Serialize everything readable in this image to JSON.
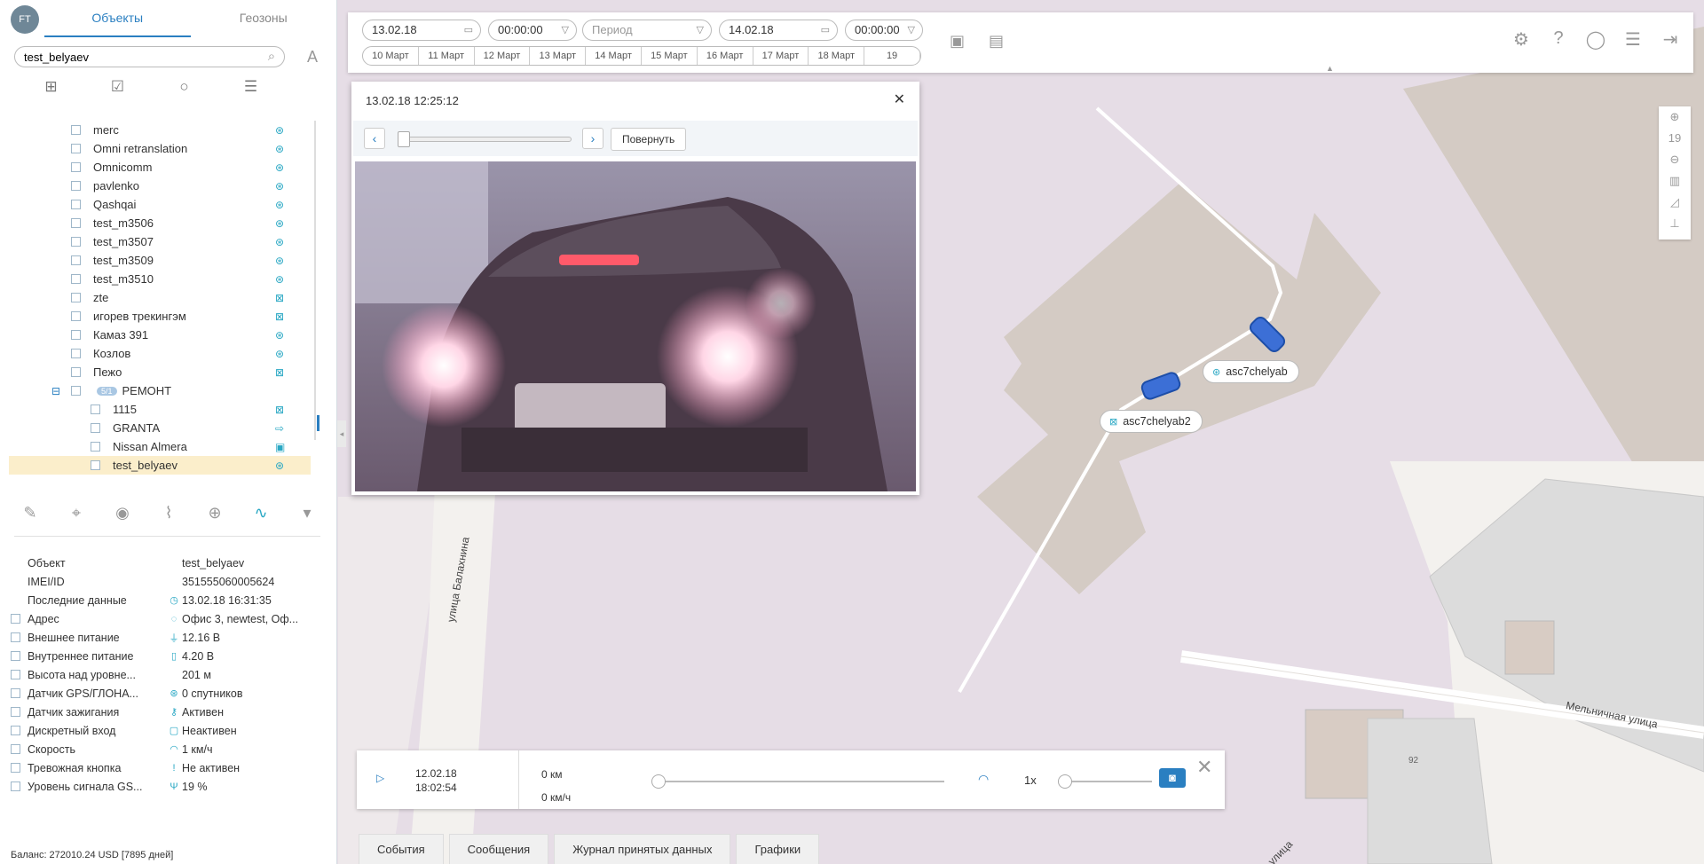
{
  "sidebar": {
    "logo": "FT",
    "tabs": [
      "Объекты",
      "Геозоны"
    ],
    "search_value": "test_belyaev",
    "font_toggle": "A",
    "objects": [
      {
        "name": "merc"
      },
      {
        "name": "Omni retranslation"
      },
      {
        "name": "Omnicomm"
      },
      {
        "name": "pavlenko"
      },
      {
        "name": "Qashqai"
      },
      {
        "name": "test_m3506"
      },
      {
        "name": "test_m3507"
      },
      {
        "name": "test_m3509"
      },
      {
        "name": "test_m3510"
      },
      {
        "name": "zte"
      },
      {
        "name": "игорев трекингэм"
      },
      {
        "name": "Камаз 391"
      },
      {
        "name": "Козлов"
      },
      {
        "name": "Пежо"
      }
    ],
    "group": {
      "badge": "5/1",
      "name": "РЕМОНТ"
    },
    "group_items": [
      {
        "name": "1115"
      },
      {
        "name": "GRANTA"
      },
      {
        "name": "Nissan Almera"
      },
      {
        "name": "test_belyaev",
        "selected": true
      }
    ],
    "properties": [
      {
        "label": "Объект",
        "value": "test_belyaev",
        "checkbox": false,
        "icon": ""
      },
      {
        "label": "IMEI/ID",
        "value": "351555060005624",
        "checkbox": false,
        "icon": ""
      },
      {
        "label": "Последние данные",
        "value": "13.02.18 16:31:35",
        "checkbox": false,
        "icon": "clock-icon"
      },
      {
        "label": "Адрес",
        "value": "Офис 3, newtest, Оф...",
        "checkbox": true,
        "icon": "pin-icon"
      },
      {
        "label": "Внешнее питание",
        "value": "12.16 В",
        "checkbox": true,
        "icon": "plug-icon"
      },
      {
        "label": "Внутреннее питание",
        "value": "4.20 В",
        "checkbox": true,
        "icon": "battery-icon"
      },
      {
        "label": "Высота над уровне...",
        "value": "201 м",
        "checkbox": true,
        "icon": ""
      },
      {
        "label": "Датчик GPS/ГЛОНА...",
        "value": "0 спутников",
        "checkbox": true,
        "icon": "satellite-icon"
      },
      {
        "label": "Датчик зажигания",
        "value": "Активен",
        "checkbox": true,
        "icon": "key-icon"
      },
      {
        "label": "Дискретный вход",
        "value": "Неактивен",
        "checkbox": true,
        "icon": "input-icon"
      },
      {
        "label": "Скорость",
        "value": "1 км/ч",
        "checkbox": true,
        "icon": "speed-icon"
      },
      {
        "label": "Тревожная кнопка",
        "value": "Не активен",
        "checkbox": true,
        "icon": "alarm-icon"
      },
      {
        "label": "Уровень сигнала GS...",
        "value": "19 %",
        "checkbox": true,
        "icon": "signal-icon"
      }
    ],
    "balance": "Баланс: 272010.24 USD [7895 дней]"
  },
  "topbar": {
    "date_from": "13.02.18",
    "time_from": "00:00:00",
    "period_placeholder": "Период",
    "date_to": "14.02.18",
    "time_to": "00:00:00",
    "timeline": [
      "10 Март",
      "11 Март",
      "12 Март",
      "13 Март",
      "14 Март",
      "15 Март",
      "16 Март",
      "17 Март",
      "18 Март",
      "19"
    ]
  },
  "zoom": {
    "level": "19"
  },
  "photo": {
    "title": "13.02.18 12:25:12",
    "rotate_label": "Повернуть"
  },
  "player": {
    "date": "12.02.18",
    "time": "18:02:54",
    "distance": "0 км",
    "speed": "0 км/ч",
    "multiplier": "1x"
  },
  "bottom_tabs": [
    "События",
    "Сообщения",
    "Журнал принятых данных",
    "Графики"
  ],
  "map": {
    "labels": [
      "asc7chelyab",
      "asc7chelyab2"
    ],
    "streets": [
      "улица Балахнина",
      "Мельничная улица",
      "улица"
    ],
    "building_number": "92"
  },
  "colors": {
    "accent": "#2a7fc1",
    "status": "#2aa8c4",
    "selected_row": "#fbeecb"
  }
}
